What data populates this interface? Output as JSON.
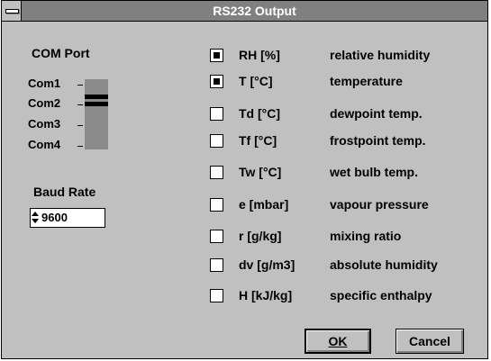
{
  "window": {
    "title": "RS232 Output"
  },
  "com_port": {
    "label": "COM Port",
    "options": [
      "Com1",
      "Com2",
      "Com3",
      "Com4"
    ],
    "selected": "Com2"
  },
  "baud_rate": {
    "label": "Baud Rate",
    "value": "9600"
  },
  "outputs": [
    {
      "code": "RH [%]",
      "description": "relative humidity",
      "checked": true
    },
    {
      "code": "T [°C]",
      "description": "temperature",
      "checked": true
    },
    {
      "code": "Td [°C]",
      "description": "dewpoint temp.",
      "checked": false
    },
    {
      "code": "Tf [°C]",
      "description": "frostpoint temp.",
      "checked": false
    },
    {
      "code": "Tw [°C]",
      "description": "wet bulb temp.",
      "checked": false
    },
    {
      "code": "e [mbar]",
      "description": "vapour pressure",
      "checked": false
    },
    {
      "code": "r [g/kg]",
      "description": "mixing ratio",
      "checked": false
    },
    {
      "code": "dv [g/m3]",
      "description": "absolute humidity",
      "checked": false
    },
    {
      "code": "H [kJ/kg]",
      "description": "specific enthalpy",
      "checked": false
    }
  ],
  "buttons": {
    "ok_label": "OK",
    "cancel_label": "Cancel"
  }
}
